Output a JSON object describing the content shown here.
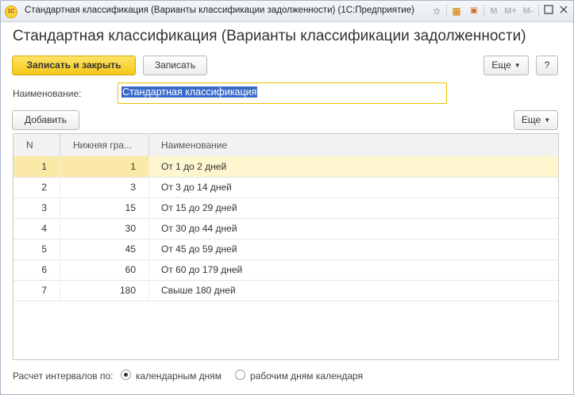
{
  "window": {
    "title": "Стандартная классификация (Варианты классификации задолженности)  (1С:Предприятие)",
    "logo_text": "1С",
    "toolbar": {
      "m_label": "M",
      "mplus_label": "M+",
      "mminus_label": "M-"
    }
  },
  "page_title": "Стандартная классификация (Варианты классификации задолженности)",
  "toolbar": {
    "save_close_label": "Записать и закрыть",
    "save_label": "Записать",
    "more_label": "Еще",
    "help_label": "?"
  },
  "name_field": {
    "label": "Наименование:",
    "value": "Стандартная классификация"
  },
  "table_toolbar": {
    "add_label": "Добавить",
    "more_label": "Еще"
  },
  "table": {
    "columns": [
      "N",
      "Нижняя гра...",
      "Наименование"
    ],
    "rows": [
      {
        "n": "1",
        "lower": "1",
        "name": "От 1 до 2 дней"
      },
      {
        "n": "2",
        "lower": "3",
        "name": "От 3 до 14 дней"
      },
      {
        "n": "3",
        "lower": "15",
        "name": "От 15 до 29 дней"
      },
      {
        "n": "4",
        "lower": "30",
        "name": "От 30 до 44 дней"
      },
      {
        "n": "5",
        "lower": "45",
        "name": "От 45 до 59 дней"
      },
      {
        "n": "6",
        "lower": "60",
        "name": "От 60 до 179 дней"
      },
      {
        "n": "7",
        "lower": "180",
        "name": "Свыше 180 дней"
      }
    ],
    "selected_row": 0
  },
  "interval_calc": {
    "label": "Расчет интервалов по:",
    "options": [
      {
        "label": "календарным дням",
        "checked": true
      },
      {
        "label": "рабочим дням календаря",
        "checked": false
      }
    ]
  },
  "colors": {
    "primary_button": "#f4c718",
    "selected_row": "#fdf6cf",
    "input_focus_border": "#e8c200",
    "text_selection": "#3a6bc9"
  }
}
